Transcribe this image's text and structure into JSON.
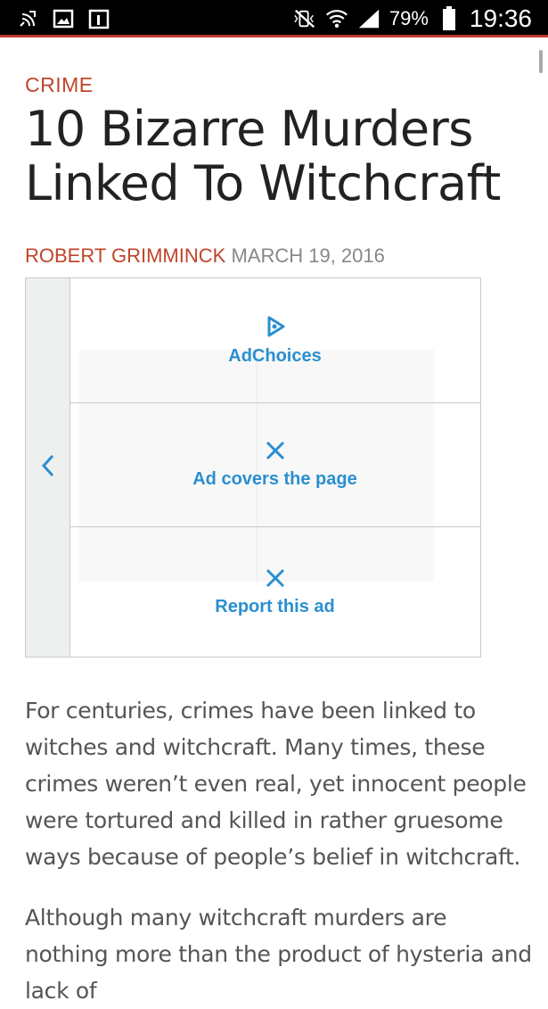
{
  "status_bar": {
    "battery": "79%",
    "time": "19:36",
    "left_icons": [
      "wifi-call-icon",
      "gallery-icon",
      "calendar-icon"
    ],
    "right_icons": [
      "mute-icon",
      "wifi-icon",
      "signal-icon",
      "battery-icon"
    ]
  },
  "article": {
    "category": "CRIME",
    "title": "10 Bizarre Murders Linked To Witchcraft",
    "author": "ROBERT GRIMMINCK",
    "date": "MARCH 19, 2016",
    "paragraphs": [
      "For centuries, crimes have been linked to witches and witchcraft. Many times, these crimes weren’t even real, yet innocent people were tortured and killed in rather gruesome ways because of people’s belief in witchcraft.",
      "Although many witchcraft murders are nothing more than the product of hysteria and lack of"
    ]
  },
  "ad": {
    "options": [
      "AdChoices",
      "Ad covers the page",
      "Report this ad"
    ]
  },
  "colors": {
    "accent": "#c0452b",
    "ad_link": "#2a8fd0",
    "body_text": "#555555",
    "title_text": "#222222"
  }
}
